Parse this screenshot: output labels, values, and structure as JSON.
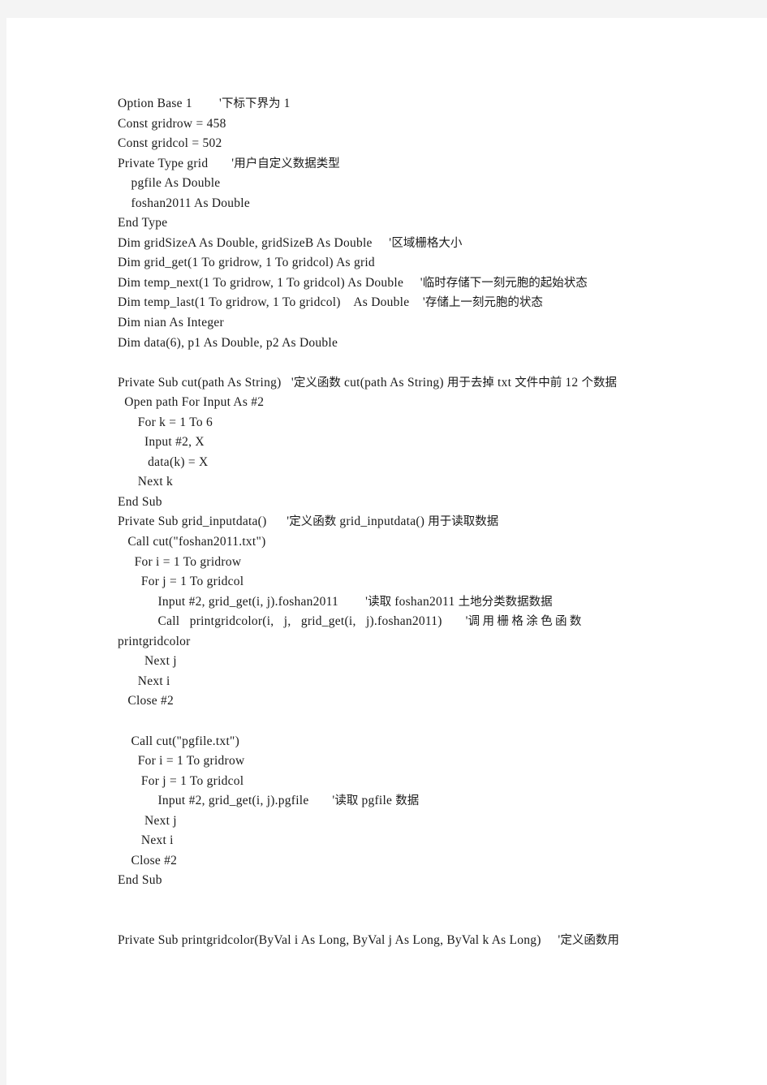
{
  "document": {
    "language": "vba",
    "page_background": "#ffffff",
    "canvas_background": "#f4f4f4",
    "text_color": "#1a1a1a",
    "code_lines": [
      {
        "id": "l1",
        "code": "Option Base 1",
        "gap": "        ",
        "comment": "'下标下界为 1"
      },
      {
        "id": "l2",
        "code": "Const gridrow = 458",
        "gap": "",
        "comment": ""
      },
      {
        "id": "l3",
        "code": "Const gridcol = 502",
        "gap": "",
        "comment": ""
      },
      {
        "id": "l4",
        "code": "Private Type grid",
        "gap": "       ",
        "comment": "'用户自定义数据类型"
      },
      {
        "id": "l5",
        "code": "    pgfile As Double",
        "gap": "",
        "comment": ""
      },
      {
        "id": "l6",
        "code": "    foshan2011 As Double",
        "gap": "",
        "comment": ""
      },
      {
        "id": "l7",
        "code": "End Type",
        "gap": "",
        "comment": ""
      },
      {
        "id": "l8",
        "code": "Dim gridSizeA As Double, gridSizeB As Double",
        "gap": "     ",
        "comment": "'区域栅格大小"
      },
      {
        "id": "l9",
        "code": "Dim grid_get(1 To gridrow, 1 To gridcol) As grid",
        "gap": "",
        "comment": ""
      },
      {
        "id": "l10",
        "code": "Dim temp_next(1 To gridrow, 1 To gridcol) As Double",
        "gap": "     ",
        "comment": "'临时存储下一刻元胞的起始状态"
      },
      {
        "id": "l11",
        "code": "Dim temp_last(1 To gridrow, 1 To gridcol)    As Double",
        "gap": "    ",
        "comment": "'存储上一刻元胞的状态"
      },
      {
        "id": "l12",
        "code": "Dim nian As Integer",
        "gap": "",
        "comment": ""
      },
      {
        "id": "l13",
        "code": "Dim data(6), p1 As Double, p2 As Double",
        "gap": "",
        "comment": ""
      },
      {
        "id": "l14",
        "code": "",
        "gap": "",
        "comment": ""
      },
      {
        "id": "l15",
        "code": "Private Sub cut(path As String)",
        "gap": "   ",
        "comment": "'定义函数 cut(path As String)  用于去掉 txt 文件中前 12 个数据"
      },
      {
        "id": "l16",
        "code": "  Open path For Input As #2",
        "gap": "",
        "comment": ""
      },
      {
        "id": "l17",
        "code": "      For k = 1 To 6",
        "gap": "",
        "comment": ""
      },
      {
        "id": "l18",
        "code": "        Input #2, X",
        "gap": "",
        "comment": ""
      },
      {
        "id": "l19",
        "code": "         data(k) = X",
        "gap": "",
        "comment": ""
      },
      {
        "id": "l20",
        "code": "      Next k",
        "gap": "",
        "comment": ""
      },
      {
        "id": "l21",
        "code": "End Sub",
        "gap": "",
        "comment": ""
      },
      {
        "id": "l22",
        "code": "Private Sub grid_inputdata()",
        "gap": "      ",
        "comment": "'定义函数 grid_inputdata() 用于读取数据"
      },
      {
        "id": "l23",
        "code": "   Call cut(\"foshan2011.txt\")",
        "gap": "",
        "comment": ""
      },
      {
        "id": "l24",
        "code": "     For i = 1 To gridrow",
        "gap": "",
        "comment": ""
      },
      {
        "id": "l25",
        "code": "       For j = 1 To gridcol",
        "gap": "",
        "comment": ""
      },
      {
        "id": "l26",
        "code": "            Input #2, grid_get(i, j).foshan2011",
        "gap": "        ",
        "comment": "'读取 foshan2011 土地分类数据数据"
      },
      {
        "id": "l27",
        "code": "            Call   printgridcolor(i,   j,   grid_get(i,   j).foshan2011)",
        "gap": "       ",
        "comment": "'调用栅格涂色函数"
      },
      {
        "id": "l28",
        "code": "printgridcolor",
        "gap": "",
        "comment": ""
      },
      {
        "id": "l29",
        "code": "        Next j",
        "gap": "",
        "comment": ""
      },
      {
        "id": "l30",
        "code": "      Next i",
        "gap": "",
        "comment": ""
      },
      {
        "id": "l31",
        "code": "   Close #2",
        "gap": "",
        "comment": ""
      },
      {
        "id": "l32",
        "code": "",
        "gap": "",
        "comment": ""
      },
      {
        "id": "l33",
        "code": "    Call cut(\"pgfile.txt\")",
        "gap": "",
        "comment": ""
      },
      {
        "id": "l34",
        "code": "      For i = 1 To gridrow",
        "gap": "",
        "comment": ""
      },
      {
        "id": "l35",
        "code": "       For j = 1 To gridcol",
        "gap": "",
        "comment": ""
      },
      {
        "id": "l36",
        "code": "            Input #2, grid_get(i, j).pgfile",
        "gap": "       ",
        "comment": "'读取 pgfile 数据"
      },
      {
        "id": "l37",
        "code": "        Next j",
        "gap": "",
        "comment": ""
      },
      {
        "id": "l38",
        "code": "       Next i",
        "gap": "",
        "comment": ""
      },
      {
        "id": "l39",
        "code": "    Close #2",
        "gap": "",
        "comment": ""
      },
      {
        "id": "l40",
        "code": "End Sub",
        "gap": "",
        "comment": ""
      },
      {
        "id": "l41",
        "code": "",
        "gap": "",
        "comment": ""
      },
      {
        "id": "l42",
        "code": "",
        "gap": "",
        "comment": ""
      },
      {
        "id": "l43",
        "code": "Private Sub printgridcolor(ByVal i As Long, ByVal j As Long, ByVal k As Long)",
        "gap": "     ",
        "comment": "'定义函数用"
      }
    ]
  }
}
